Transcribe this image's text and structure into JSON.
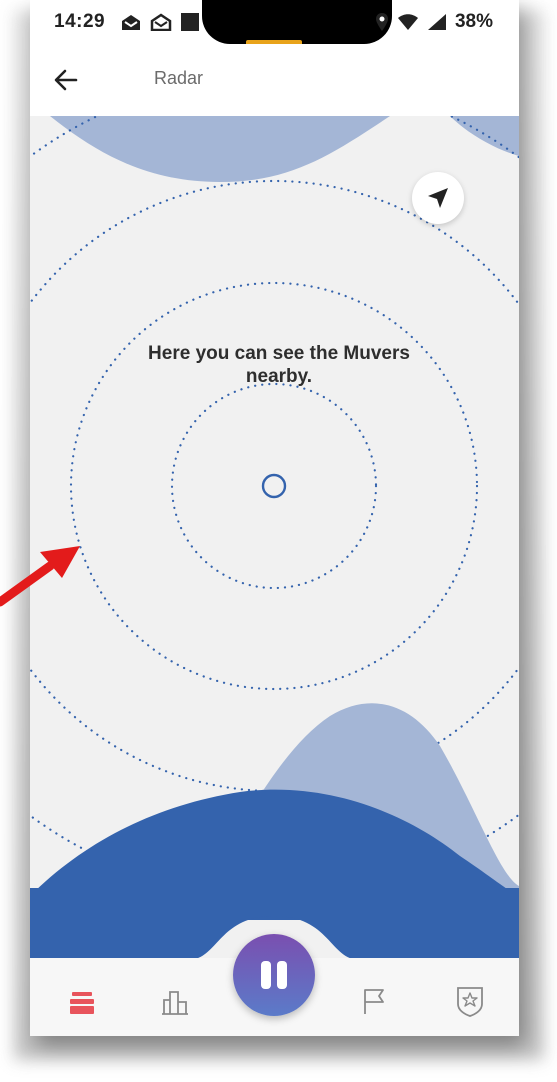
{
  "status_bar": {
    "time": "14:29",
    "battery": "38%"
  },
  "app_bar": {
    "title": "Radar",
    "back_icon": "arrow-left-icon"
  },
  "radar": {
    "message": "Here you can see the Muvers nearby.",
    "locate_icon": "navigation-arrow-icon",
    "center_icon": "circle-icon"
  },
  "bottom_nav": {
    "items": [
      {
        "icon": "stack-icon",
        "active": true
      },
      {
        "icon": "bar-chart-icon",
        "active": false
      },
      {
        "icon": "flag-icon",
        "active": false
      },
      {
        "icon": "star-badge-icon",
        "active": false
      }
    ],
    "center_action_icon": "pause-icon"
  },
  "colors": {
    "accent_dark": "#3463ad",
    "accent_light": "#a4b6d6",
    "active_nav": "#e8545c",
    "inactive_nav": "#8a8a8a"
  }
}
